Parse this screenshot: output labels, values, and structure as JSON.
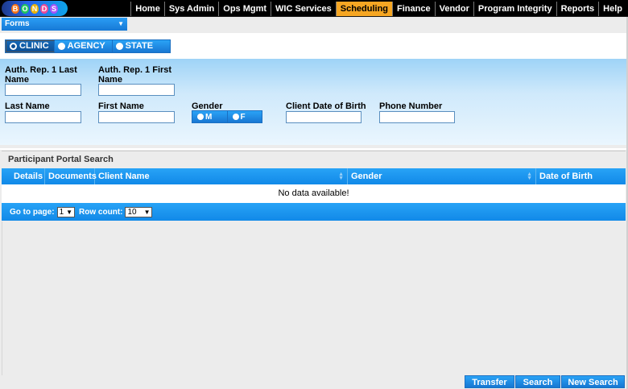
{
  "logo": {
    "letters": [
      "B",
      "O",
      "N",
      "D",
      "S"
    ]
  },
  "nav": [
    {
      "label": "Home",
      "active": false
    },
    {
      "label": "Sys Admin",
      "active": false
    },
    {
      "label": "Ops Mgmt",
      "active": false
    },
    {
      "label": "WIC Services",
      "active": false
    },
    {
      "label": "Scheduling",
      "active": true
    },
    {
      "label": "Finance",
      "active": false
    },
    {
      "label": "Vendor",
      "active": false
    },
    {
      "label": "Program Integrity",
      "active": false
    },
    {
      "label": "Reports",
      "active": false
    },
    {
      "label": "Help",
      "active": false
    }
  ],
  "forms_dropdown": {
    "label": "Forms"
  },
  "scope": [
    {
      "label": "CLINIC",
      "selected": true
    },
    {
      "label": "AGENCY",
      "selected": false
    },
    {
      "label": "STATE",
      "selected": false
    }
  ],
  "criteria": {
    "auth_rep_last": {
      "label": "Auth. Rep. 1 Last Name",
      "value": ""
    },
    "auth_rep_first": {
      "label": "Auth. Rep. 1 First Name",
      "value": ""
    },
    "last_name": {
      "label": "Last Name",
      "value": ""
    },
    "first_name": {
      "label": "First Name",
      "value": ""
    },
    "gender": {
      "label": "Gender",
      "options": [
        "M",
        "F"
      ]
    },
    "dob": {
      "label": "Client Date of Birth",
      "value": ""
    },
    "phone": {
      "label": "Phone Number",
      "value": ""
    }
  },
  "results": {
    "title": "Participant Portal Search",
    "columns": [
      "Details",
      "Documents",
      "Client Name",
      "Gender",
      "Date of Birth"
    ],
    "empty_message": "No data available!",
    "pager": {
      "goto_label": "Go to page:",
      "page_value": "1",
      "rowcount_label": "Row count:",
      "rowcount_value": "10"
    }
  },
  "buttons": {
    "transfer": "Transfer",
    "search": "Search",
    "new_search": "New Search"
  }
}
